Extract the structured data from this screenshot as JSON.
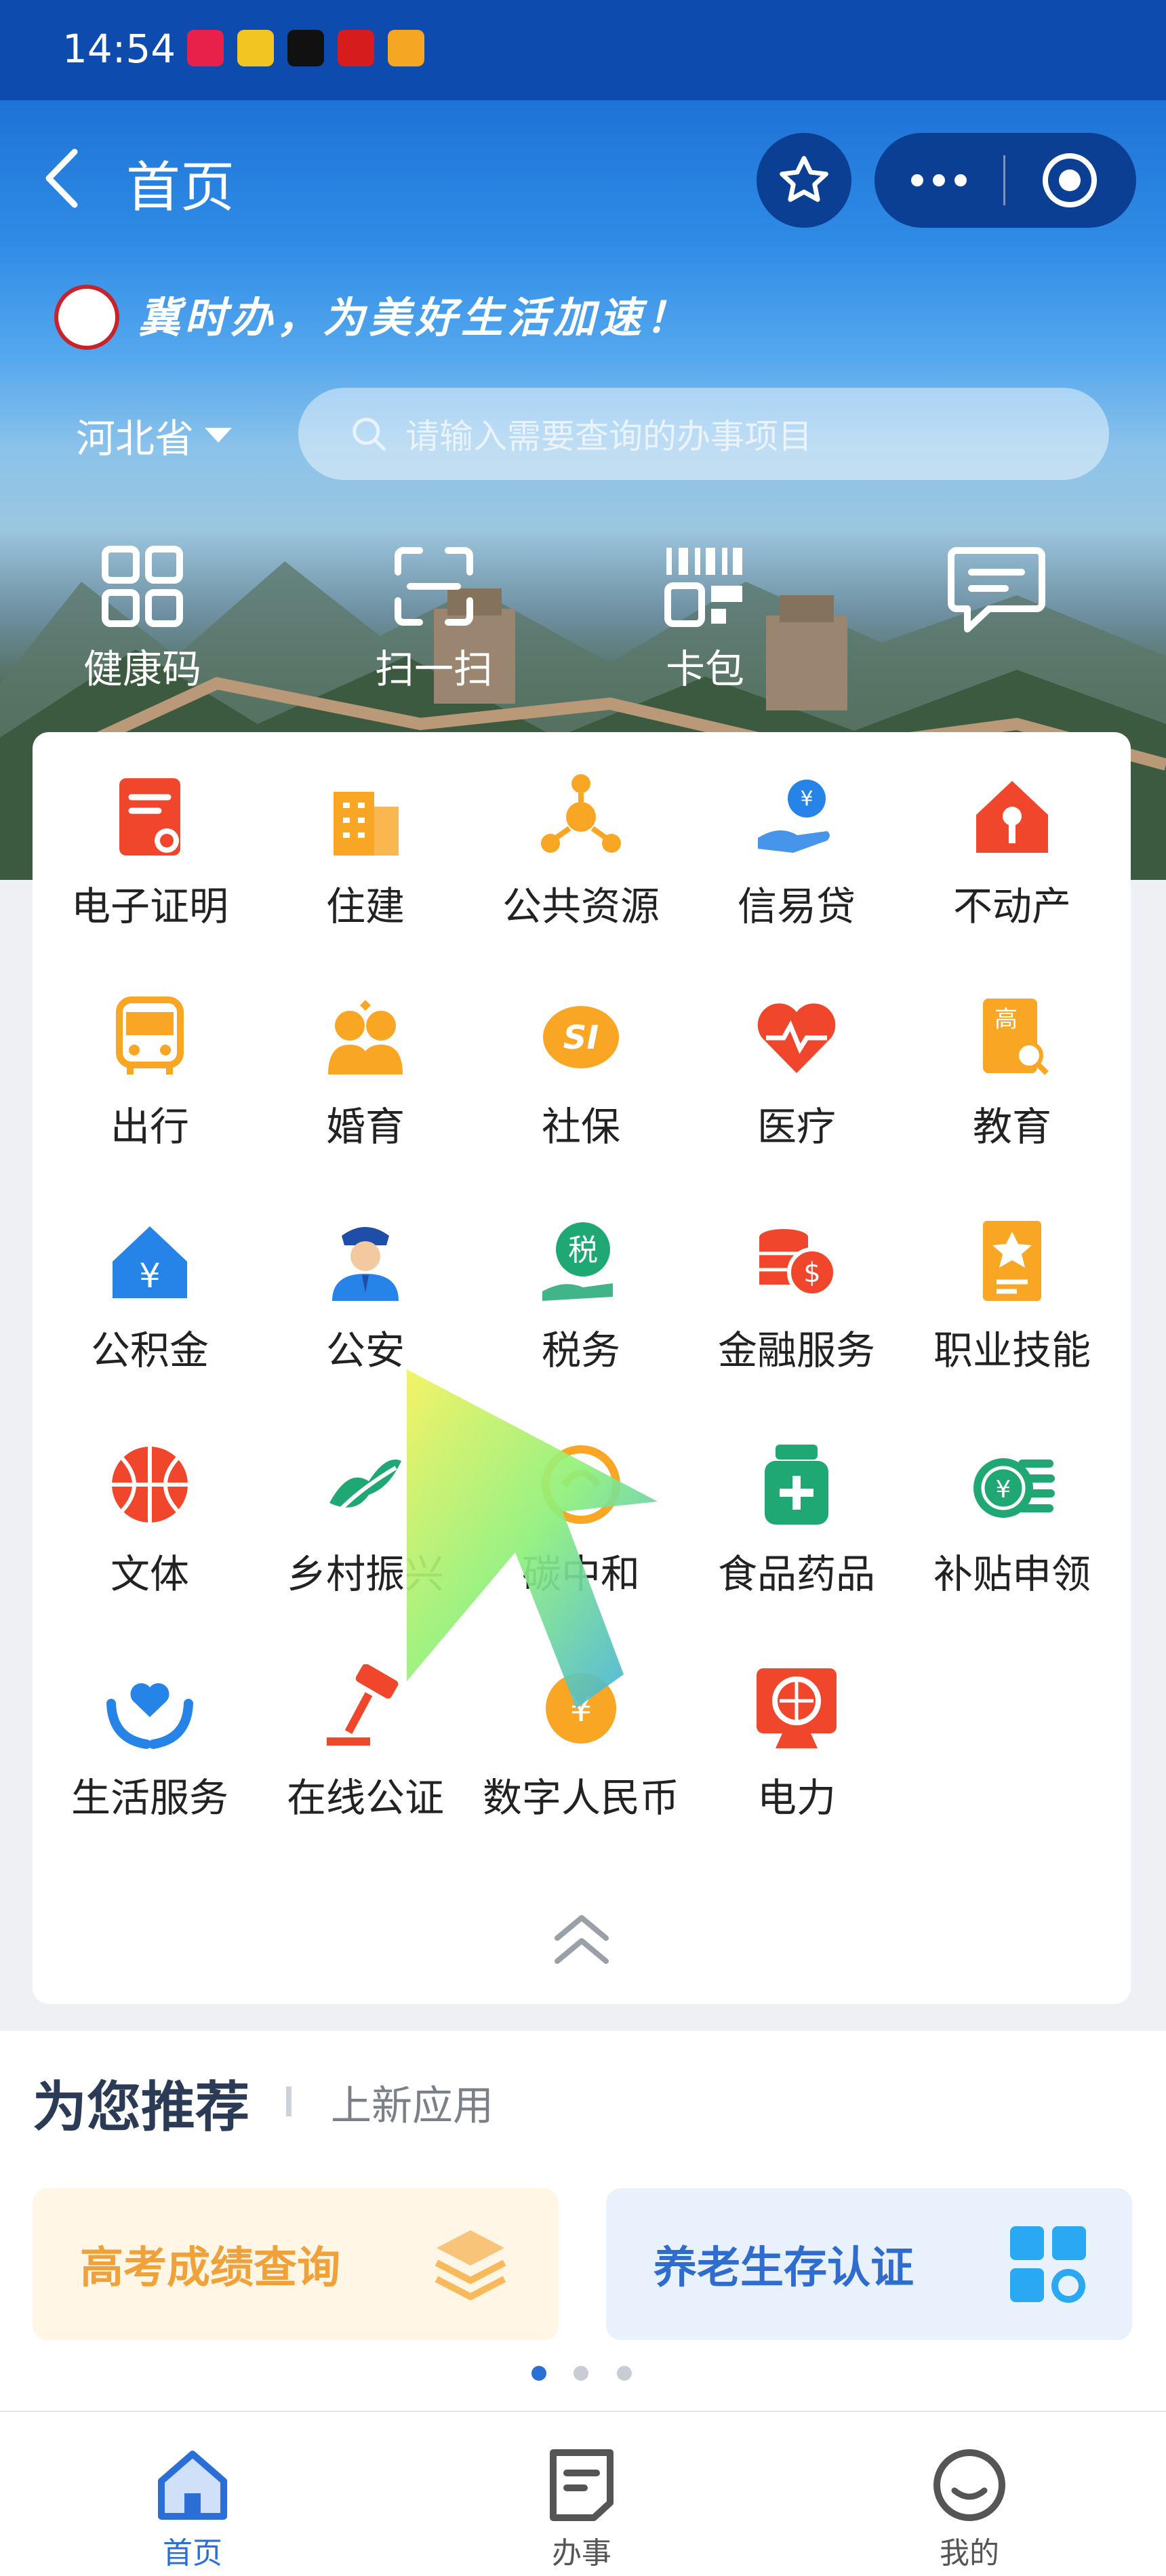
{
  "status_bar": {
    "time": "14:54"
  },
  "header": {
    "title": "首页"
  },
  "banner": {
    "slogan": "冀时办，为美好生活加速！"
  },
  "location": {
    "province": "河北省"
  },
  "search": {
    "placeholder": "请输入需要查询的办事项目"
  },
  "quick_actions": [
    {
      "label": "健康码",
      "icon": "qr-grid-icon"
    },
    {
      "label": "扫一扫",
      "icon": "scan-icon"
    },
    {
      "label": "卡包",
      "icon": "barcode-card-icon"
    },
    {
      "label": "",
      "icon": "message-icon"
    }
  ],
  "services": [
    {
      "label": "电子证明",
      "icon": "certificate-icon",
      "color": "#f0472c"
    },
    {
      "label": "住建",
      "icon": "building-icon",
      "color": "#f8a623"
    },
    {
      "label": "公共资源",
      "icon": "network-icon",
      "color": "#f8a623"
    },
    {
      "label": "信易贷",
      "icon": "loan-hand-icon",
      "color": "#2683e8"
    },
    {
      "label": "不动产",
      "icon": "house-key-icon",
      "color": "#f0472c"
    },
    {
      "label": "出行",
      "icon": "bus-icon",
      "color": "#f8a623"
    },
    {
      "label": "婚育",
      "icon": "couple-icon",
      "color": "#f8a623"
    },
    {
      "label": "社保",
      "icon": "social-security-icon",
      "color": "#f8a623"
    },
    {
      "label": "医疗",
      "icon": "heart-pulse-icon",
      "color": "#f0472c"
    },
    {
      "label": "教育",
      "icon": "education-icon",
      "color": "#f8a623"
    },
    {
      "label": "公积金",
      "icon": "housing-fund-icon",
      "color": "#2683e8"
    },
    {
      "label": "公安",
      "icon": "police-icon",
      "color": "#2683e8"
    },
    {
      "label": "税务",
      "icon": "tax-icon",
      "color": "#1fa874"
    },
    {
      "label": "金融服务",
      "icon": "coins-icon",
      "color": "#f0472c"
    },
    {
      "label": "职业技能",
      "icon": "skill-badge-icon",
      "color": "#f8a623"
    },
    {
      "label": "文体",
      "icon": "basketball-icon",
      "color": "#f0472c"
    },
    {
      "label": "乡村振兴",
      "icon": "rural-icon",
      "color": "#1fa874"
    },
    {
      "label": "碳中和",
      "icon": "carbon-icon",
      "color": "#f8a623"
    },
    {
      "label": "食品药品",
      "icon": "medicine-bottle-icon",
      "color": "#1fa874"
    },
    {
      "label": "补贴申领",
      "icon": "subsidy-icon",
      "color": "#1fa874"
    },
    {
      "label": "生活服务",
      "icon": "care-hands-icon",
      "color": "#2683e8"
    },
    {
      "label": "在线公证",
      "icon": "gavel-icon",
      "color": "#f0472c"
    },
    {
      "label": "数字人民币",
      "icon": "digital-rmb-icon",
      "color": "#f8a623"
    },
    {
      "label": "电力",
      "icon": "power-icon",
      "color": "#f0472c"
    }
  ],
  "recommend": {
    "title": "为您推荐",
    "subtitle": "上新应用",
    "cards": [
      {
        "label": "高考成绩查询",
        "color": "#f0a13a",
        "bg": "#fff6e6"
      },
      {
        "label": "养老生存认证",
        "color": "#2f6ccf",
        "bg": "#e9f1fd"
      }
    ]
  },
  "tabs": [
    {
      "label": "首页",
      "active": true
    },
    {
      "label": "办事",
      "active": false
    },
    {
      "label": "我的",
      "active": false
    }
  ],
  "colors": {
    "primary": "#1e73d6",
    "tab_active": "#2b6fd6",
    "tab_inactive": "#555"
  }
}
